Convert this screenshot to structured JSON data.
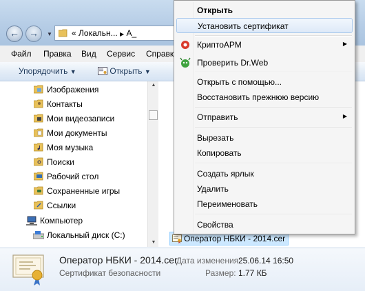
{
  "address": {
    "crumb_overflow": "«",
    "crumb_1": "Локальн...",
    "crumb_sep": "▶",
    "crumb_2": "А_"
  },
  "menubar": [
    "Файл",
    "Правка",
    "Вид",
    "Сервис",
    "Справка"
  ],
  "toolbar": {
    "organize": "Упорядочить",
    "open": "Открыть"
  },
  "nav": {
    "items": [
      {
        "label": "Изображения",
        "icon": "pictures-folder-icon"
      },
      {
        "label": "Контакты",
        "icon": "contacts-folder-icon"
      },
      {
        "label": "Мои видеозаписи",
        "icon": "videos-folder-icon"
      },
      {
        "label": "Мои документы",
        "icon": "documents-folder-icon"
      },
      {
        "label": "Моя музыка",
        "icon": "music-folder-icon"
      },
      {
        "label": "Поиски",
        "icon": "searches-folder-icon"
      },
      {
        "label": "Рабочий стол",
        "icon": "desktop-folder-icon"
      },
      {
        "label": "Сохраненные игры",
        "icon": "saved-games-folder-icon"
      },
      {
        "label": "Ссылки",
        "icon": "links-folder-icon"
      },
      {
        "label": "Компьютер",
        "icon": "computer-icon"
      },
      {
        "label": "Локальный диск (C:)",
        "icon": "drive-icon"
      }
    ]
  },
  "file": {
    "name": "Оператор НБКИ - 2014.cer"
  },
  "context_menu": {
    "items": [
      {
        "label": "Открыть",
        "bold": true
      },
      {
        "label": "Установить сертификат",
        "highlighted": true
      },
      {
        "label": "КриптоАРМ",
        "submenu": true,
        "icon": "cryptoarm-icon"
      },
      {
        "label": "Проверить Dr.Web",
        "icon": "drweb-icon"
      },
      {
        "label": "Открыть с помощью..."
      },
      {
        "label": "Восстановить прежнюю версию"
      },
      {
        "label": "Отправить",
        "submenu": true
      },
      {
        "label": "Вырезать"
      },
      {
        "label": "Копировать"
      },
      {
        "label": "Создать ярлык"
      },
      {
        "label": "Удалить"
      },
      {
        "label": "Переименовать"
      },
      {
        "label": "Свойства"
      }
    ]
  },
  "details": {
    "name": "Оператор НБКИ - 2014.cer",
    "type": "Сертификат безопасности",
    "modified_label": "Дата изменения:",
    "modified_value": "25.06.14 16:50",
    "size_label": "Размер:",
    "size_value": "1.77 КБ"
  }
}
